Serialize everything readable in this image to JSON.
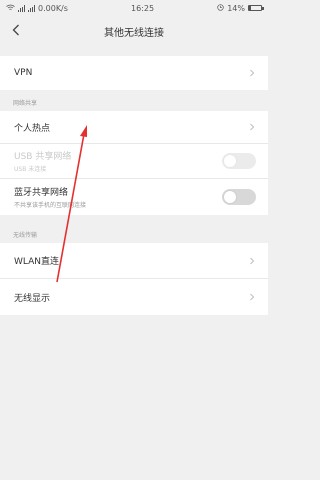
{
  "status_bar": {
    "net_speed": "0.00K/s",
    "time": "16:25",
    "battery_text": "14%",
    "battery_level": 0.14
  },
  "header": {
    "title": "其他无线连接"
  },
  "groups": {
    "vpn": {
      "label": "VPN"
    },
    "tethering_section": "网络共享",
    "hotspot": {
      "label": "个人热点"
    },
    "usb": {
      "label": "USB 共享网络",
      "sub": "USB 未连接"
    },
    "bluetooth": {
      "label": "蓝牙共享网络",
      "sub": "不共享该手机的互联网连接"
    },
    "wireless_section": "无线传输",
    "wlan_direct": {
      "label": "WLAN直连"
    },
    "wireless_display": {
      "label": "无线显示"
    }
  },
  "colors": {
    "annotation_arrow": "#e53030",
    "background": "#f0f0f0"
  },
  "icons": {
    "back": "chevron-left-icon",
    "row_arrow": "chevron-right-icon"
  }
}
